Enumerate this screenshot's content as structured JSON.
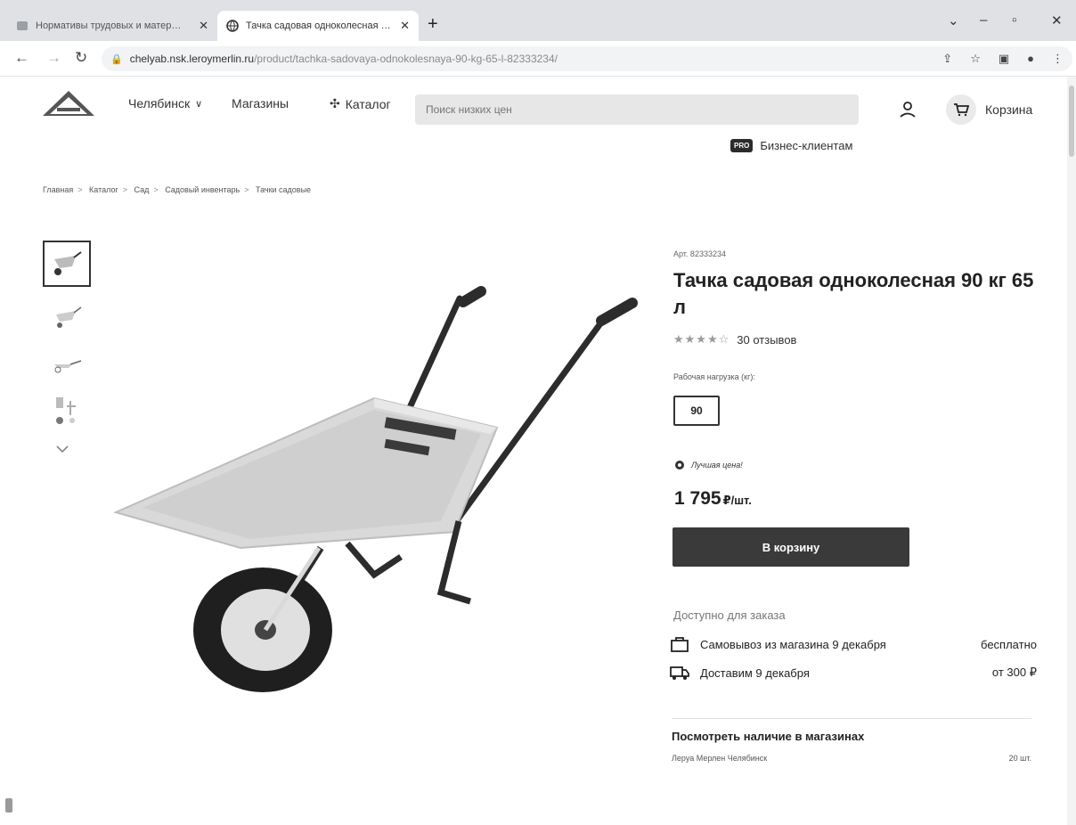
{
  "browser": {
    "tabs": [
      {
        "title": "Нормативы трудовых и матер…"
      },
      {
        "title": "Тачка садовая одноколесная 9…"
      }
    ],
    "url_host": "chelyab.nsk.leroymerlin.ru",
    "url_path": "/product/tachka-sadovaya-odnokolesnaya-90-kg-65-l-82333234/"
  },
  "header": {
    "city": "Челябинск",
    "stores": "Магазины",
    "catalog": "Каталог",
    "search_placeholder": "Поиск низких цен",
    "cart": "Корзина",
    "pro_badge": "PRO",
    "business": "Бизнес-клиентам"
  },
  "breadcrumbs": [
    "Главная",
    "Каталог",
    "Сад",
    "Садовый инвентарь",
    "Тачки садовые"
  ],
  "product": {
    "article": "Арт. 82333234",
    "title": "Тачка садовая одноколесная 90 кг 65 л",
    "rating": 3.5,
    "reviews": "30 отзывов",
    "load_label": "Рабочая нагрузка (кг):",
    "load_option": "90",
    "best_price": "Лучшая цена!",
    "price": "1 795",
    "price_unit": "₽/шт.",
    "buy_button": "В корзину"
  },
  "availability": {
    "title": "Доступно для заказа",
    "pickup_label": "Самовывоз из магазина 9 декабря",
    "pickup_value": "бесплатно",
    "delivery_label": "Доставим 9 декабря",
    "delivery_value": "от 300 ₽"
  },
  "stock": {
    "title": "Посмотреть наличие в магазинах",
    "store": "Леруа Мерлен Челябинск",
    "qty": "20 шт."
  },
  "colors": {
    "button": "#3a3a3a",
    "tray": "#d9d9d9",
    "frame": "#2c2c2c"
  }
}
